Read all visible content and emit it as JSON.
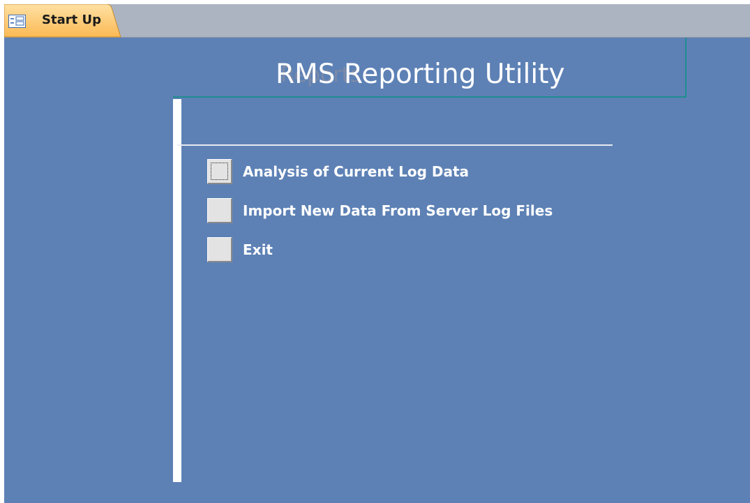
{
  "tab": {
    "icon": "form-icon",
    "label": "Start Up"
  },
  "form": {
    "ghost_text": "Reports",
    "title": "RMS Reporting Utility",
    "menu_items": [
      {
        "label": "Analysis of Current Log Data",
        "focused": true
      },
      {
        "label": "Import New Data From Server Log Files",
        "focused": false
      },
      {
        "label": "Exit",
        "focused": false
      }
    ]
  },
  "colors": {
    "form_background": "#5d81b5",
    "tab_strip": "#acb4c1",
    "tab_active": "#fdc36a",
    "title_frame_border": "#1f8d8f"
  }
}
